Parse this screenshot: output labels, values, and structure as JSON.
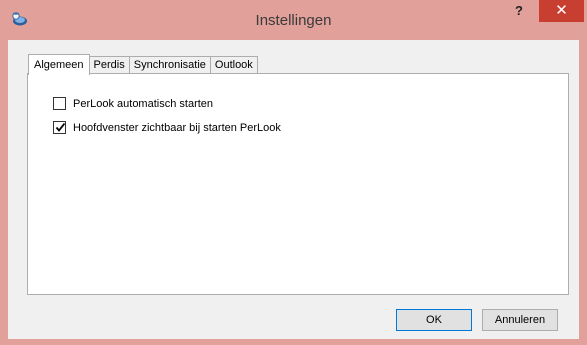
{
  "window": {
    "title": "Instellingen",
    "help_label": "?",
    "close_label": "✕",
    "accent": "#e1a09a",
    "close_color": "#c83e30"
  },
  "tabs": [
    {
      "label": "Algemeen",
      "active": true
    },
    {
      "label": "Perdis",
      "active": false
    },
    {
      "label": "Synchronisatie",
      "active": false
    },
    {
      "label": "Outlook",
      "active": false
    }
  ],
  "options": [
    {
      "label": "PerLook automatisch starten",
      "checked": false
    },
    {
      "label": "Hoofdvenster zichtbaar bij starten PerLook",
      "checked": true
    }
  ],
  "buttons": {
    "ok_label": "OK",
    "cancel_label": "Annuleren"
  },
  "icons": {
    "app": "app-icon",
    "check": "check-icon"
  }
}
